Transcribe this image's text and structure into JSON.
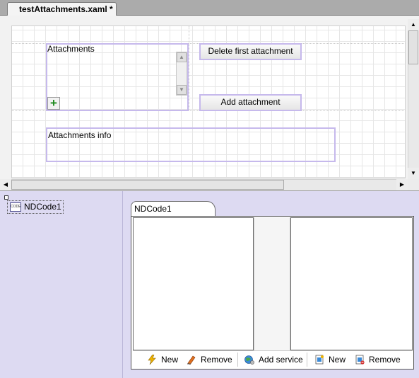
{
  "document": {
    "tab_title": "testAttachments.xaml *"
  },
  "designer": {
    "attachments_label": "Attachments",
    "add_icon": "plus-icon",
    "delete_button": "Delete first attachment",
    "add_button": "Add attachment",
    "info_label": "Attachments info"
  },
  "tray": {
    "component_name": "NDCode1",
    "component_icon": "code-icon",
    "icon_text": "CODE"
  },
  "component_editor": {
    "tab_label": "NDCode1",
    "toolbar": [
      {
        "label": "New",
        "icon": "lightning-icon"
      },
      {
        "label": "Remove",
        "icon": "eraser-icon"
      },
      {
        "label": "Add service",
        "icon": "globe-gear-icon"
      },
      {
        "label": "New",
        "icon": "page-new-icon"
      },
      {
        "label": "Remove",
        "icon": "page-remove-icon"
      }
    ]
  },
  "colors": {
    "selection_border": "#c6b9ec",
    "bottom_background": "#dddaf2",
    "plus_green": "#1f8a1f"
  }
}
